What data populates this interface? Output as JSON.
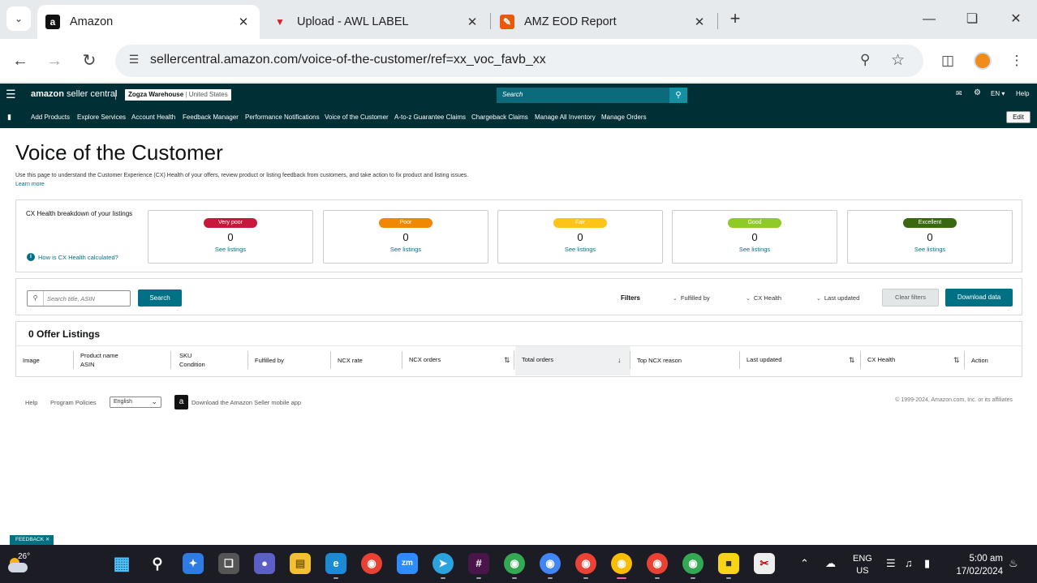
{
  "browser": {
    "tabs": [
      {
        "title": "Amazon",
        "favicon": "amazon-favicon",
        "active": true
      },
      {
        "title": "Upload - AWL LABEL",
        "favicon": "awl-favicon",
        "active": false
      },
      {
        "title": "AMZ EOD Report",
        "favicon": "report-favicon",
        "active": false
      }
    ],
    "url": "sellercentral.amazon.com/voice-of-the-customer/ref=xx_voc_favb_xx"
  },
  "header": {
    "logo_bold": "amazon",
    "logo_rest": " seller central",
    "account_name": "Zogza Warehouse",
    "account_separator": "|",
    "account_region": "United States",
    "search_placeholder": "Search",
    "language": "EN",
    "help": "Help"
  },
  "nav": {
    "items": [
      "Add Products",
      "Explore Services",
      "Account Health",
      "Feedback Manager",
      "Performance Notifications",
      "Voice of the Customer",
      "A-to-z Guarantee Claims",
      "Chargeback Claims",
      "Manage All Inventory",
      "Manage Orders"
    ],
    "edit": "Edit"
  },
  "page": {
    "title": "Voice of the Customer",
    "description": "Use this page to understand the Customer Experience (CX) Health of your offers, review product or listing feedback from customers, and take action to fix product and listing issues.",
    "learn_more": "Learn more"
  },
  "breakdown": {
    "title": "CX Health breakdown of your listings",
    "info_link": "How is CX Health calculated?",
    "cards": [
      {
        "label": "Very poor",
        "count": "0",
        "link": "See listings",
        "color": "#c7183c"
      },
      {
        "label": "Poor",
        "count": "0",
        "link": "See listings",
        "color": "#f08804"
      },
      {
        "label": "Fair",
        "count": "0",
        "link": "See listings",
        "color": "#fcc419"
      },
      {
        "label": "Good",
        "count": "0",
        "link": "See listings",
        "color": "#8fcb27"
      },
      {
        "label": "Excellent",
        "count": "0",
        "link": "See listings",
        "color": "#38680f"
      }
    ]
  },
  "filters": {
    "search_placeholder": "Search title, ASIN",
    "search_button": "Search",
    "label": "Filters",
    "fulfilled_by": "Fulfilled by",
    "cx_health": "CX Health",
    "last_updated": "Last updated",
    "clear": "Clear filters",
    "download": "Download data"
  },
  "table": {
    "title": "0 Offer Listings",
    "columns": [
      {
        "line1": "Image",
        "line2": ""
      },
      {
        "line1": "Product name",
        "line2": "ASIN"
      },
      {
        "line1": "SKU",
        "line2": "Condition"
      },
      {
        "line1": "Fulfilled by",
        "line2": ""
      },
      {
        "line1": "NCX rate",
        "line2": ""
      },
      {
        "line1": "NCX orders",
        "line2": ""
      },
      {
        "line1": "Total orders",
        "line2": ""
      },
      {
        "line1": "Top NCX reason",
        "line2": ""
      },
      {
        "line1": "Last updated",
        "line2": ""
      },
      {
        "line1": "CX Health",
        "line2": ""
      },
      {
        "line1": "Action",
        "line2": ""
      }
    ]
  },
  "footer": {
    "help": "Help",
    "policies": "Program Policies",
    "language": "English",
    "app": "Download the Amazon Seller mobile app",
    "copyright": "© 1999-2024, Amazon.com, Inc. or its affiliates"
  },
  "feedback": "FEEDBACK",
  "taskbar": {
    "temperature": "26°",
    "lang_top": "ENG",
    "lang_bottom": "US",
    "time": "5:00 am",
    "date": "17/02/2024"
  }
}
